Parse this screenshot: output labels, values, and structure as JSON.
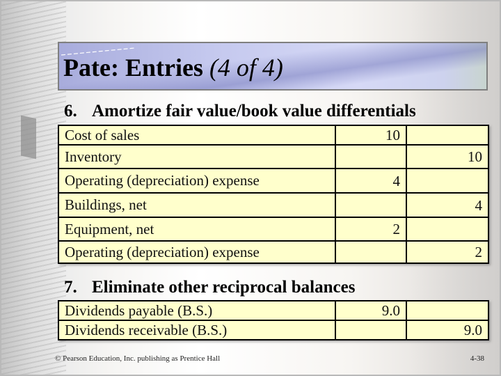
{
  "slide": {
    "title_main": "Pate: Entries",
    "title_sub": "(4 of 4)"
  },
  "sections": [
    {
      "number": "6.",
      "heading": "Amortize fair value/book value differentials",
      "rows": [
        {
          "account": "Cost of sales",
          "debit": "10",
          "credit": "",
          "indent": false
        },
        {
          "account": "Inventory",
          "debit": "",
          "credit": "10",
          "indent": true
        },
        {
          "account": "Operating (depreciation) expense",
          "debit": "4",
          "credit": "",
          "indent": false
        },
        {
          "account": "Buildings, net",
          "debit": "",
          "credit": "4",
          "indent": true
        },
        {
          "account": "Equipment, net",
          "debit": "2",
          "credit": "",
          "indent": false
        },
        {
          "account": "Operating (depreciation) expense",
          "debit": "",
          "credit": "2",
          "indent": true
        }
      ]
    },
    {
      "number": "7.",
      "heading": "Eliminate other reciprocal balances",
      "rows": [
        {
          "account": "Dividends payable (B.S.)",
          "debit": "9.0",
          "credit": "",
          "indent": false
        },
        {
          "account": "Dividends receivable (B.S.)",
          "debit": "",
          "credit": "9.0",
          "indent": true
        }
      ]
    }
  ],
  "footer": {
    "copyright": "© Pearson Education, Inc. publishing as Prentice Hall",
    "page_number": "4-38"
  },
  "colors": {
    "table_fill": "#ffffcc",
    "title_band": "#c4c8ee"
  }
}
